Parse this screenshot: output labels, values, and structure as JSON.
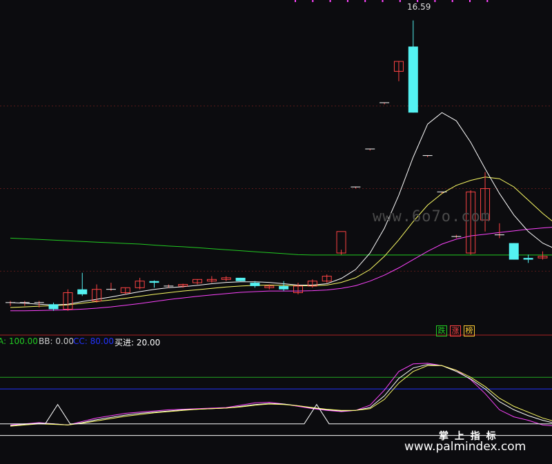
{
  "chart_data": [
    {
      "type": "candlestick",
      "title": "",
      "high_annotation": "16.59",
      "colors": {
        "up": "#ff4444",
        "down": "#54f2f2",
        "ma_short": "#ffffff",
        "ma_mid": "#ffff66",
        "ma_long": "#ff44ff",
        "ma_very_long": "#22cc22",
        "grid": "#5a1a1a"
      },
      "candles": [
        {
          "o": 8.05,
          "h": 8.1,
          "l": 7.95,
          "c": 8.05
        },
        {
          "o": 8.05,
          "h": 8.1,
          "l": 7.95,
          "c": 8.05
        },
        {
          "o": 8.05,
          "h": 8.1,
          "l": 7.9,
          "c": 8.05
        },
        {
          "o": 8.0,
          "h": 8.05,
          "l": 7.8,
          "c": 7.85
        },
        {
          "o": 7.85,
          "h": 8.45,
          "l": 7.8,
          "c": 8.35
        },
        {
          "o": 8.45,
          "h": 8.95,
          "l": 8.25,
          "c": 8.3
        },
        {
          "o": 8.1,
          "h": 8.6,
          "l": 8.05,
          "c": 8.45
        },
        {
          "o": 8.45,
          "h": 8.65,
          "l": 8.4,
          "c": 8.45
        },
        {
          "o": 8.35,
          "h": 8.5,
          "l": 8.3,
          "c": 8.5
        },
        {
          "o": 8.5,
          "h": 8.8,
          "l": 8.45,
          "c": 8.7
        },
        {
          "o": 8.7,
          "h": 8.72,
          "l": 8.5,
          "c": 8.65
        },
        {
          "o": 8.55,
          "h": 8.6,
          "l": 8.5,
          "c": 8.55
        },
        {
          "o": 8.55,
          "h": 8.62,
          "l": 8.5,
          "c": 8.6
        },
        {
          "o": 8.65,
          "h": 8.75,
          "l": 8.6,
          "c": 8.75
        },
        {
          "o": 8.7,
          "h": 8.85,
          "l": 8.65,
          "c": 8.75
        },
        {
          "o": 8.75,
          "h": 8.85,
          "l": 8.7,
          "c": 8.8
        },
        {
          "o": 8.8,
          "h": 8.8,
          "l": 8.7,
          "c": 8.7
        },
        {
          "o": 8.65,
          "h": 8.7,
          "l": 8.5,
          "c": 8.55
        },
        {
          "o": 8.5,
          "h": 8.6,
          "l": 8.45,
          "c": 8.55
        },
        {
          "o": 8.55,
          "h": 8.7,
          "l": 8.4,
          "c": 8.45
        },
        {
          "o": 8.35,
          "h": 8.65,
          "l": 8.3,
          "c": 8.55
        },
        {
          "o": 8.55,
          "h": 8.75,
          "l": 8.5,
          "c": 8.7
        },
        {
          "o": 8.7,
          "h": 8.9,
          "l": 8.65,
          "c": 8.85
        },
        {
          "o": 9.55,
          "h": 9.65,
          "l": 9.5,
          "c": 10.2
        },
        {
          "o": 11.55,
          "h": 11.55,
          "l": 11.5,
          "c": 11.55
        },
        {
          "o": 12.7,
          "h": 12.7,
          "l": 12.65,
          "c": 12.7
        },
        {
          "o": 14.1,
          "h": 14.1,
          "l": 14.05,
          "c": 14.1
        },
        {
          "o": 15.05,
          "h": 15.35,
          "l": 14.75,
          "c": 15.35
        },
        {
          "o": 15.8,
          "h": 16.59,
          "l": 13.8,
          "c": 13.8
        },
        {
          "o": 12.5,
          "h": 12.5,
          "l": 12.45,
          "c": 12.5
        },
        {
          "o": 11.4,
          "h": 11.4,
          "l": 11.35,
          "c": 11.4
        },
        {
          "o": 10.05,
          "h": 10.1,
          "l": 10.0,
          "c": 10.05
        },
        {
          "o": 9.55,
          "h": 11.45,
          "l": 9.5,
          "c": 11.4
        },
        {
          "o": 10.55,
          "h": 12.0,
          "l": 10.2,
          "c": 11.5
        },
        {
          "o": 10.1,
          "h": 10.45,
          "l": 10.0,
          "c": 10.1
        },
        {
          "o": 9.85,
          "h": 9.85,
          "l": 9.35,
          "c": 9.35
        },
        {
          "o": 9.4,
          "h": 9.5,
          "l": 9.25,
          "c": 9.35
        },
        {
          "o": 9.4,
          "h": 9.6,
          "l": 9.35,
          "c": 9.45
        },
        {
          "o": 9.45,
          "h": 9.85,
          "l": 9.4,
          "c": 9.8
        },
        {
          "o": 9.8,
          "h": 9.9,
          "l": 9.7,
          "c": 9.85
        }
      ],
      "ma_short": [
        8.05,
        8.03,
        8.0,
        7.98,
        8.0,
        8.08,
        8.15,
        8.22,
        8.3,
        8.38,
        8.45,
        8.5,
        8.53,
        8.57,
        8.62,
        8.66,
        8.68,
        8.68,
        8.66,
        8.62,
        8.58,
        8.58,
        8.62,
        8.78,
        9.05,
        9.55,
        10.3,
        11.3,
        12.45,
        13.45,
        13.8,
        13.55,
        12.9,
        12.1,
        11.35,
        10.7,
        10.2,
        9.85,
        9.65,
        9.6
      ],
      "ma_mid": [
        7.9,
        7.92,
        7.94,
        7.96,
        7.98,
        8.03,
        8.08,
        8.13,
        8.18,
        8.24,
        8.3,
        8.35,
        8.4,
        8.44,
        8.48,
        8.52,
        8.55,
        8.57,
        8.58,
        8.57,
        8.56,
        8.56,
        8.58,
        8.66,
        8.8,
        9.05,
        9.45,
        9.95,
        10.5,
        11.0,
        11.35,
        11.6,
        11.75,
        11.85,
        11.8,
        11.55,
        11.15,
        10.75,
        10.4,
        10.1
      ],
      "ma_long": [
        7.8,
        7.8,
        7.81,
        7.82,
        7.83,
        7.85,
        7.88,
        7.92,
        7.97,
        8.02,
        8.08,
        8.14,
        8.19,
        8.24,
        8.28,
        8.32,
        8.36,
        8.38,
        8.4,
        8.4,
        8.4,
        8.41,
        8.43,
        8.48,
        8.56,
        8.7,
        8.88,
        9.1,
        9.35,
        9.6,
        9.82,
        9.97,
        10.07,
        10.12,
        10.17,
        10.22,
        10.27,
        10.31,
        10.34,
        10.37
      ],
      "ma_very_long": [
        10.0,
        9.98,
        9.96,
        9.94,
        9.92,
        9.9,
        9.88,
        9.86,
        9.84,
        9.82,
        9.79,
        9.76,
        9.74,
        9.71,
        9.68,
        9.65,
        9.62,
        9.59,
        9.56,
        9.53,
        9.5,
        9.49,
        9.49,
        9.49,
        9.49,
        9.49,
        9.49,
        9.49,
        9.49,
        9.49,
        9.49,
        9.49,
        9.49,
        9.49,
        9.49,
        9.49,
        9.49,
        9.49,
        9.49,
        9.49
      ],
      "ylim": [
        7.4,
        17.0
      ]
    },
    {
      "type": "line",
      "indicator_labels": {
        "a": "A: 100.00",
        "bb": "BB: 0.00",
        "cc": "CC: 80.00",
        "buy": "买进: 20.00"
      },
      "reference_lines": [
        {
          "name": "A",
          "value": 100
        },
        {
          "name": "CC",
          "value": 80
        },
        {
          "name": "BB",
          "value": 0
        },
        {
          "name": "buy",
          "value": 20
        }
      ],
      "series": [
        {
          "color": "#ff44ff",
          "values": [
            18,
            20,
            22,
            20,
            18,
            24,
            30,
            34,
            38,
            40,
            42,
            44,
            45,
            46,
            47,
            48,
            52,
            56,
            57,
            54,
            50,
            46,
            43,
            41,
            43,
            52,
            78,
            110,
            123,
            124,
            120,
            112,
            96,
            72,
            44,
            32,
            26,
            18,
            16,
            17
          ]
        },
        {
          "color": "#ffffff",
          "values": [
            17,
            19,
            21,
            20,
            18,
            22,
            27,
            31,
            35,
            38,
            40,
            42,
            44,
            45,
            46,
            47,
            50,
            53,
            55,
            54,
            51,
            47,
            44,
            42,
            43,
            48,
            68,
            98,
            116,
            122,
            120,
            110,
            97,
            80,
            58,
            44,
            34,
            26,
            20,
            19
          ]
        },
        {
          "color": "#ffff66",
          "values": [
            16,
            18,
            20,
            19,
            18,
            21,
            25,
            29,
            33,
            36,
            39,
            41,
            43,
            45,
            46,
            47,
            49,
            52,
            54,
            53,
            51,
            48,
            45,
            43,
            43,
            46,
            62,
            90,
            110,
            120,
            120,
            112,
            100,
            84,
            64,
            50,
            40,
            30,
            23,
            21
          ]
        }
      ],
      "signal_spikes": [
        3,
        21
      ],
      "ylim": [
        -10,
        150
      ]
    }
  ],
  "badges": [
    {
      "text": "跌",
      "color": "#22cc22"
    },
    {
      "text": "涨",
      "color": "#ff4444"
    },
    {
      "text": "榜",
      "color": "#ffcc33"
    }
  ],
  "watermarks": {
    "main": "www.6o7o.com",
    "footer": "www.palmindex.com",
    "footer_cn": "掌 上 指 标"
  }
}
